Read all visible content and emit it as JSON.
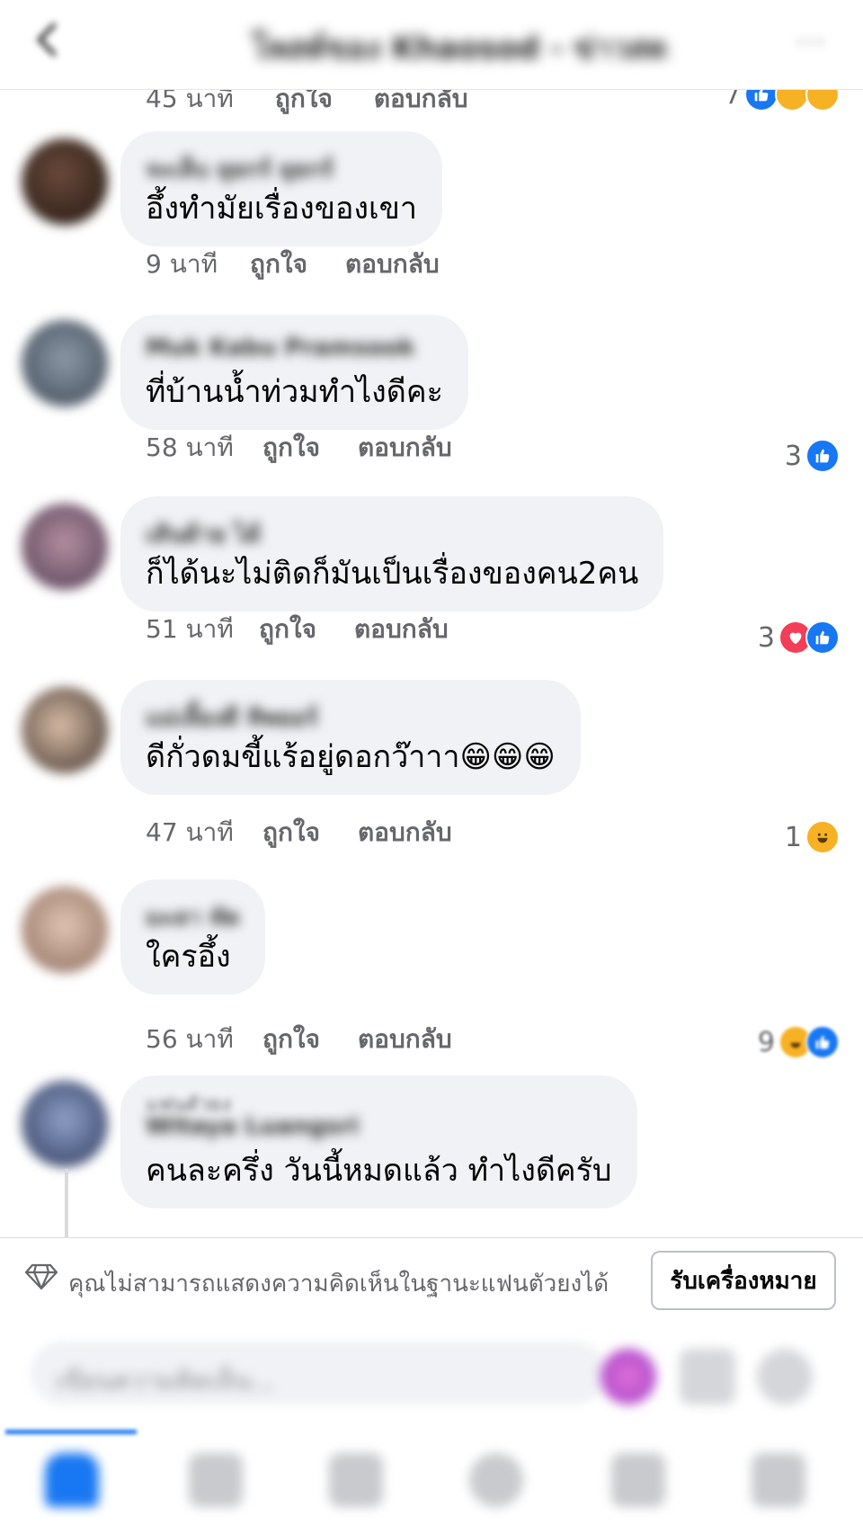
{
  "header": {
    "title": "โพสต์ของ Khaosod - ข่าวสด",
    "more": "···"
  },
  "top_meta": {
    "time": "45 นาที",
    "like": "ถูกใจ",
    "reply": "ตอบกลับ",
    "reaction_count": "7"
  },
  "comments": [
    {
      "name": "จะเล็บ ยุยกร์ ยุยกร์",
      "text": "อึ้งทำมัยเรื่องของเขา",
      "time": "9 นาที",
      "like": "ถูกใจ",
      "reply": "ตอบกลับ",
      "reaction_count": "",
      "reactions": []
    },
    {
      "name": "Muk Kabu Pramsook",
      "text": "ที่บ้านน้ำท่วมทำไงดีคะ",
      "time": "58 นาที",
      "like": "ถูกใจ",
      "reply": "ตอบกลับ",
      "reaction_count": "3",
      "reactions": [
        "like"
      ]
    },
    {
      "name": "เส้นด้าย ได้",
      "text": "ก็ได้นะไม่ติดก็มันเป็นเรื่องของคน2คน",
      "time": "51 นาที",
      "like": "ถูกใจ",
      "reply": "ตอบกลับ",
      "reaction_count": "3",
      "reactions": [
        "love",
        "like"
      ]
    },
    {
      "name": "แม่เลี้ยงดี ทิพยอร์",
      "text": "ดีกั่วดมขี้แร้อยู่ดอกว๊าาา😁😁😁",
      "time": "47 นาที",
      "like": "ถูกใจ",
      "reply": "ตอบกลับ",
      "reaction_count": "1",
      "reactions": [
        "haha"
      ]
    },
    {
      "name": "มะลา ทัด",
      "text": "ใครอึ้ง",
      "time": "56 นาที",
      "like": "ถูกใจ",
      "reply": "ตอบกลับ",
      "reaction_count": "9",
      "reactions": [
        "haha",
        "like"
      ]
    },
    {
      "badge": "แฟนตัวยง",
      "name": "Witaya Luangsri",
      "text": "คนละครึ่ง วันนี้หมดแล้ว ทำไงดีครับ"
    }
  ],
  "notice": {
    "text": "คุณไม่สามารถแสดงความคิดเห็นในฐานะแฟนตัวยงได้",
    "button": "รับเครื่องหมาย"
  },
  "composer": {
    "placeholder": "เขียนความคิดเห็น..."
  },
  "colors": {
    "accent": "#1877f2",
    "love": "#f33e58",
    "haha": "#f7b125",
    "bubble": "#f0f2f5"
  }
}
